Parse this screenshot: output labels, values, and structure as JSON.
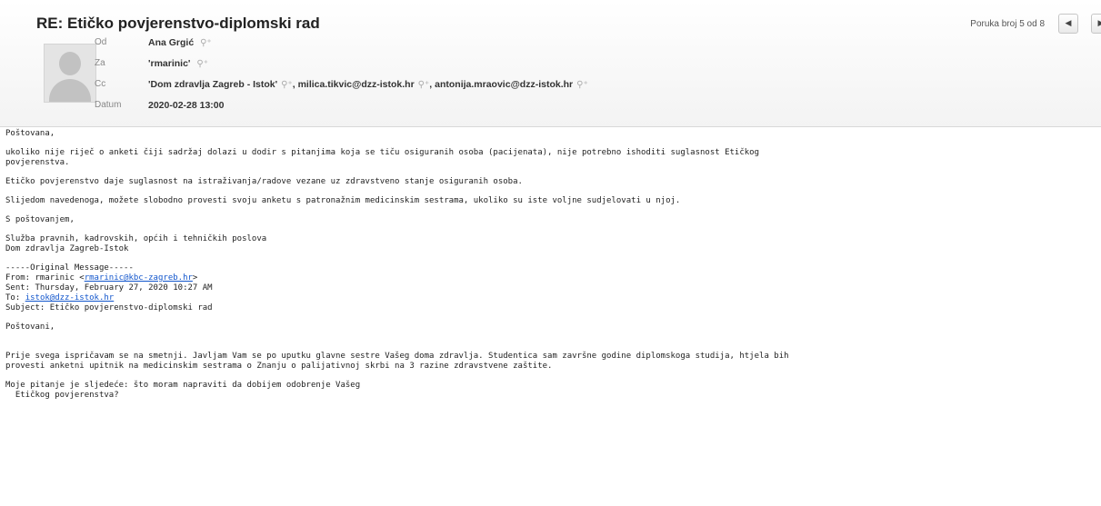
{
  "header": {
    "subject": "RE: Etičko povjerenstvo-diplomski rad",
    "pager_text": "Poruka broj 5 od 8",
    "prev_icon": "◀",
    "next_icon": "▶",
    "fields": {
      "from_label": "Od",
      "from_value": "Ana Grgić",
      "to_label": "Za",
      "to_value": "'rmarinic'",
      "cc_label": "Cc",
      "cc_values": [
        "'Dom zdravlja Zagreb - Istok'",
        "milica.tikvic@dzz-istok.hr",
        "antonija.mraovic@dzz-istok.hr"
      ],
      "date_label": "Datum",
      "date_value": "2020-02-28 13:00"
    },
    "add_contact_icon": "⚲⁺"
  },
  "body": {
    "greeting": "Poštovana,",
    "para1": "ukoliko nije riječ o anketi čiji sadržaj dolazi u dodir s pitanjima koja se tiču osiguranih osoba (pacijenata), nije potrebno ishoditi suglasnost Etičkog\npovjerenstva.",
    "para2": "Etičko povjerenstvo daje suglasnost na istraživanja/radove vezane uz zdravstveno stanje osiguranih osoba.",
    "para3": "Slijedom navedenoga, možete slobodno provesti svoju anketu s patronažnim medicinskim sestrama, ukoliko su iste voljne sudjelovati u njoj.",
    "closing": "S poštovanjem,",
    "signature": "Služba pravnih, kadrovskih, općih i tehničkih poslova\nDom zdravlja Zagreb-Istok",
    "original": {
      "marker": "-----Original Message-----",
      "from_prefix": "From: rmarinic <",
      "from_email": "rmarinic@kbc-zagreb.hr",
      "from_suffix": ">",
      "sent": "Sent: Thursday, February 27, 2020 10:27 AM",
      "to_prefix": "To: ",
      "to_email": "istok@dzz-istok.hr",
      "subject": "Subject: Etičko povjerenstvo-diplomski rad"
    },
    "greeting2": "Poštovani,",
    "para4": "Prije svega ispričavam se na smetnji. Javljam Vam se po uputku glavne sestre Vašeg doma zdravlja. Studentica sam završne godine diplomskoga studija, htjela bih\nprovesti anketni upitnik na medicinskim sestrama o Znanju o palijativnoj skrbi na 3 razine zdravstvene zaštite.",
    "para5": "Moje pitanje je sljedeće: što moram napraviti da dobijem odobrenje Vašeg\n  Etičkog povjerenstva?"
  }
}
